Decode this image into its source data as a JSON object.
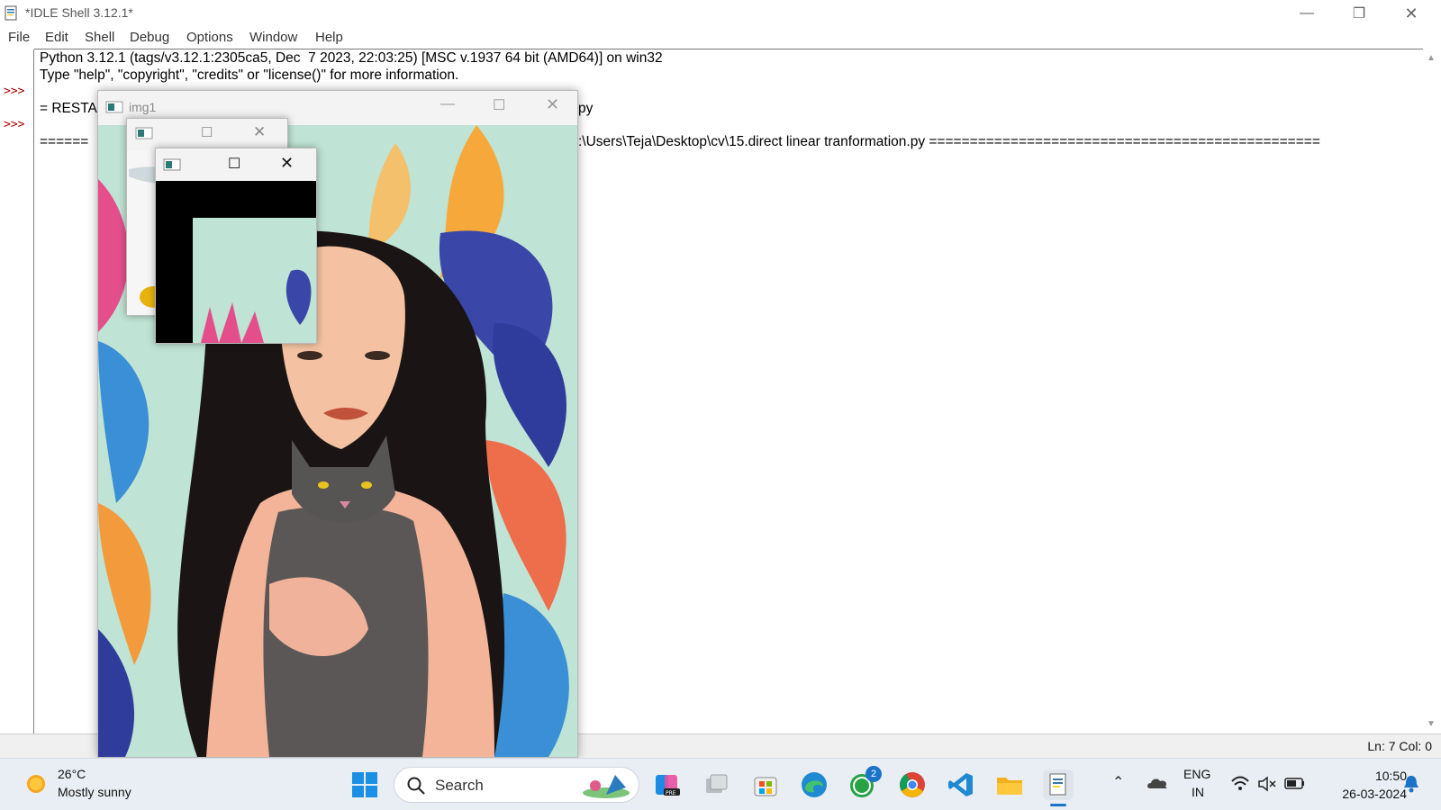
{
  "window": {
    "title": "*IDLE Shell 3.12.1*",
    "minimize": "—",
    "restore": "❐",
    "close": "✕"
  },
  "menu": [
    "File",
    "Edit",
    "Shell",
    "Debug",
    "Options",
    "Window",
    "Help"
  ],
  "shell": {
    "prompts": [
      ">>>",
      ">>>"
    ],
    "lines": [
      "Python 3.12.1 (tags/v3.12.1:2305ca5, Dec  7 2023, 22:03:25) [MSC v.1937 64 bit (AMD64)] on win32",
      "Type \"help\", \"copyright\", \"credits\" or \"license()\" for more information.",
      "= RESTA",
      "py",
      "======",
      ":\\Users\\Teja\\Desktop\\cv\\15.direct linear tranformation.py ================================================"
    ]
  },
  "status": {
    "position": "Ln: 7   Col: 0"
  },
  "img1_window": {
    "title": "img1"
  },
  "taskbar": {
    "weather_temp": "26°C",
    "weather_desc": "Mostly sunny",
    "search_placeholder": "Search",
    "whatsapp_badge": "2",
    "lang_top": "ENG",
    "lang_bottom": "IN",
    "time": "10:50",
    "date": "26-03-2024"
  },
  "icons": [
    "python-idle-icon",
    "windows-start-icon",
    "search-icon",
    "copilot-icon",
    "task-view-icon",
    "microsoft-store-icon",
    "edge-icon",
    "whatsapp-icon",
    "chrome-icon",
    "vscode-icon",
    "file-explorer-icon",
    "idle-taskbar-icon",
    "chevron-up-icon",
    "onedrive-icon",
    "wifi-icon",
    "speaker-muted-icon",
    "battery-icon",
    "notification-bell-icon"
  ]
}
